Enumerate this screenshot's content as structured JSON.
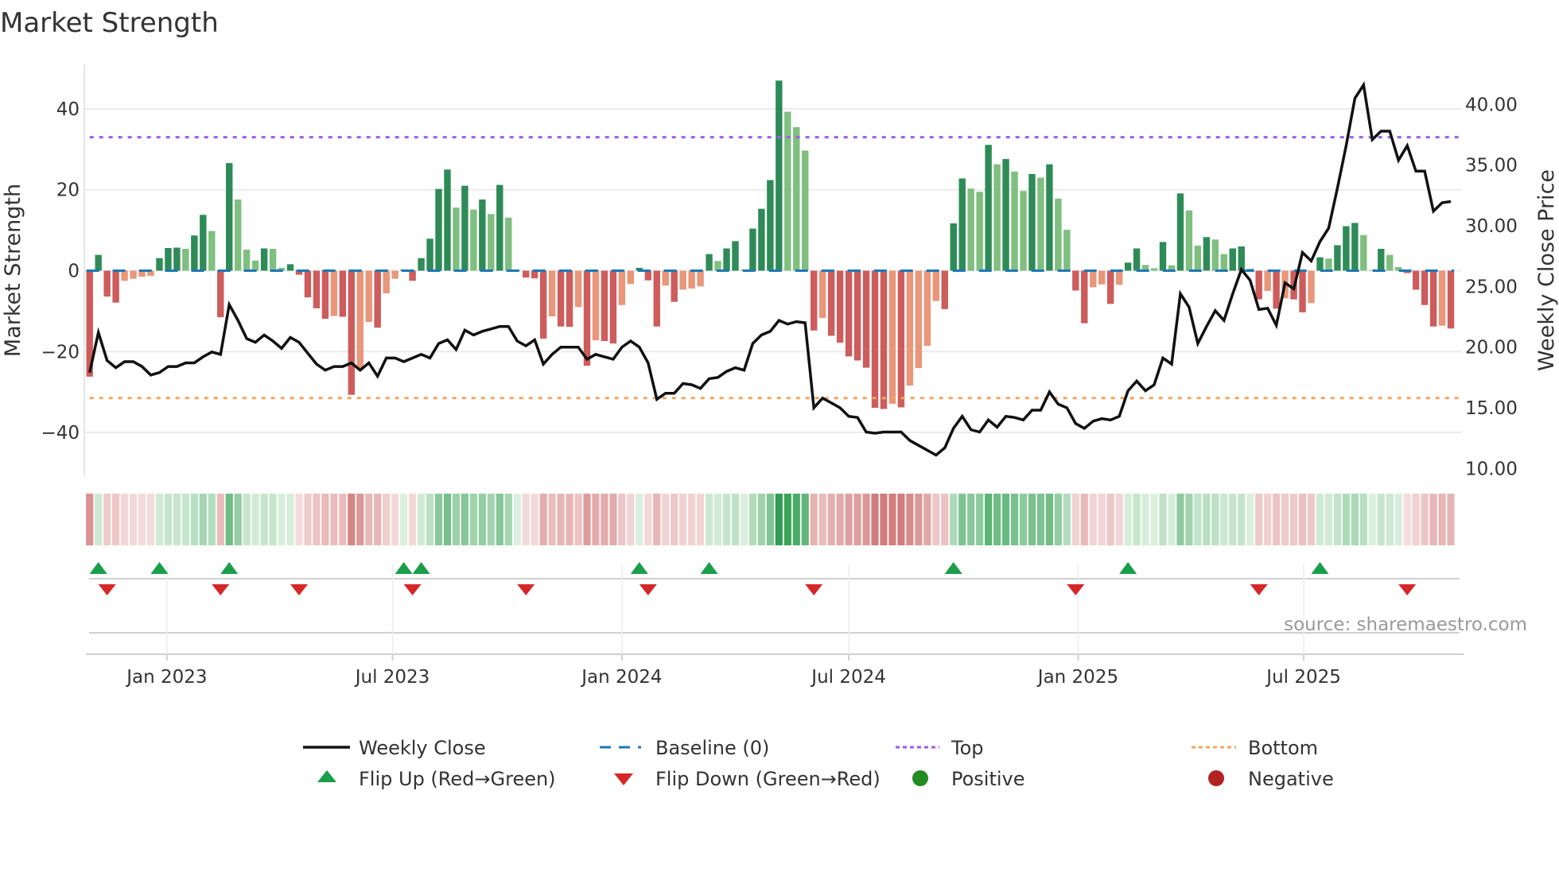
{
  "chart_data": {
    "type": "bar",
    "title": "Market Strength",
    "ylabel": "Market Strength",
    "y2label": "Weekly Close Price",
    "ylim": [
      -51,
      51
    ],
    "y2lim": [
      9.3,
      43.3
    ],
    "yticks": [
      40,
      20,
      0,
      -20,
      -40
    ],
    "yticklabels": [
      "40",
      "20",
      "0",
      "−20",
      "−40"
    ],
    "y2ticks": [
      40,
      35,
      30,
      25,
      20,
      15,
      10
    ],
    "y2ticklabels": [
      "40.00",
      "35.00",
      "30.00",
      "25.00",
      "20.00",
      "15.00",
      "10.00"
    ],
    "xticks": [
      "2023-01-01",
      "2023-07-01",
      "2024-01-01",
      "2024-07-01",
      "2025-01-01",
      "2025-07-01"
    ],
    "xticklabels": [
      "Jan 2023",
      "Jul 2023",
      "Jan 2024",
      "Jul 2024",
      "Jan 2025",
      "Jul 2025"
    ],
    "start_date": "2022-10-31",
    "frequency": "weekly",
    "top_level": 33.0,
    "bottom_level": -31.5,
    "baseline": 0,
    "strength": [
      -26.2,
      3.9,
      -6.4,
      -7.9,
      -2.5,
      -2.0,
      -1.5,
      -1.3,
      3.1,
      5.6,
      5.7,
      5.4,
      8.7,
      13.8,
      9.8,
      -11.5,
      26.6,
      17.6,
      5.2,
      2.5,
      5.5,
      5.4,
      0.7,
      1.6,
      -1.0,
      -6.6,
      -9.3,
      -11.9,
      -11.2,
      -11.4,
      -30.7,
      -24.5,
      -12.7,
      -14.1,
      -5.6,
      -2.0,
      0.3,
      -2.5,
      3.1,
      7.9,
      20.2,
      25.0,
      15.6,
      21.0,
      15.1,
      17.6,
      14.0,
      21.2,
      13.1,
      0.2,
      -1.7,
      -1.9,
      -16.8,
      -11.3,
      -13.8,
      -13.9,
      -9.0,
      -23.5,
      -17.2,
      -17.4,
      -18.0,
      -8.5,
      -3.3,
      0.7,
      -2.4,
      -13.8,
      -3.7,
      -7.7,
      -4.7,
      -4.4,
      -3.9,
      4.1,
      2.4,
      5.5,
      7.3,
      0.3,
      10.4,
      15.3,
      22.4,
      47.0,
      39.3,
      35.5,
      29.7,
      -14.8,
      -11.7,
      -16.1,
      -17.8,
      -21.2,
      -22.2,
      -24.0,
      -33.9,
      -34.2,
      -32.9,
      -33.8,
      -28.4,
      -24.1,
      -18.6,
      -7.5,
      -9.5,
      11.7,
      22.8,
      20.3,
      19.5,
      31.1,
      26.3,
      27.6,
      24.5,
      19.7,
      23.9,
      23.0,
      26.3,
      17.8,
      10.1,
      -4.9,
      -13.0,
      -4.1,
      -3.4,
      -8.2,
      -3.5,
      2.0,
      5.5,
      1.4,
      0.6,
      7.1,
      1.3,
      19.1,
      14.9,
      6.2,
      8.3,
      7.7,
      4.1,
      5.5,
      6.0,
      0.5,
      -7.1,
      -5.0,
      -9.4,
      -6.8,
      -7.1,
      -10.3,
      -8.0,
      3.3,
      3.0,
      6.3,
      11.0,
      11.8,
      8.8,
      0.2,
      5.4,
      3.9,
      0.9,
      -0.6,
      -4.7,
      -8.5,
      -13.8,
      -13.6,
      -14.3
    ],
    "weekly_close": [
      17.9,
      21.2,
      18.9,
      18.3,
      18.8,
      18.8,
      18.4,
      17.7,
      17.9,
      18.4,
      18.4,
      18.7,
      18.7,
      19.2,
      19.6,
      19.4,
      23.5,
      22.2,
      20.7,
      20.4,
      21.0,
      20.5,
      19.9,
      20.8,
      20.4,
      19.5,
      18.6,
      18.1,
      18.4,
      18.4,
      18.7,
      18.1,
      18.7,
      17.6,
      19.1,
      19.1,
      18.8,
      19.1,
      19.4,
      19.1,
      20.3,
      20.6,
      19.8,
      21.4,
      21.0,
      21.3,
      21.5,
      21.7,
      21.7,
      20.5,
      20.1,
      20.6,
      18.6,
      19.4,
      20.0,
      20.0,
      20.0,
      19.0,
      19.4,
      19.2,
      19.0,
      20.0,
      20.5,
      20.0,
      18.7,
      15.7,
      16.2,
      16.2,
      17.0,
      16.9,
      16.6,
      17.4,
      17.5,
      18.0,
      18.3,
      18.1,
      20.3,
      21.0,
      21.3,
      22.2,
      21.9,
      22.1,
      22.0,
      15.0,
      15.8,
      15.4,
      15.0,
      14.3,
      14.2,
      13.0,
      12.9,
      13.0,
      13.0,
      13.0,
      12.3,
      11.9,
      11.5,
      11.1,
      11.7,
      13.3,
      14.3,
      13.2,
      13.0,
      14.0,
      13.4,
      14.3,
      14.2,
      14.0,
      14.8,
      14.8,
      16.3,
      15.3,
      15.0,
      13.7,
      13.3,
      13.9,
      14.1,
      14.0,
      14.3,
      16.4,
      17.2,
      16.4,
      16.9,
      19.1,
      18.6,
      24.4,
      23.3,
      20.3,
      21.7,
      23.0,
      22.2,
      24.4,
      26.4,
      25.5,
      23.1,
      23.2,
      21.8,
      25.3,
      24.8,
      27.8,
      27.1,
      28.7,
      29.8,
      33.1,
      36.6,
      40.5,
      41.6,
      37.1,
      37.8,
      37.8,
      35.4,
      36.6,
      34.5,
      34.5,
      31.2,
      31.9,
      32.0
    ],
    "flip_up": [
      "2022-11-07",
      "2022-12-26",
      "2023-02-20",
      "2023-07-10",
      "2023-07-24",
      "2024-01-15",
      "2024-03-11",
      "2024-09-23",
      "2025-02-10",
      "2025-07-14"
    ],
    "flip_down": [
      "2022-11-14",
      "2023-02-13",
      "2023-04-17",
      "2023-07-17",
      "2023-10-16",
      "2024-01-22",
      "2024-06-03",
      "2024-12-30",
      "2025-05-26",
      "2025-09-22"
    ],
    "legend": {
      "placement": "bottom",
      "weekly_close": "Weekly Close",
      "baseline": "Baseline (0)",
      "top": "Top",
      "bottom": "Bottom",
      "flip_up": "Flip Up (Red→Green)",
      "flip_down": "Flip Down (Green→Red)",
      "positive": "Positive",
      "negative": "Negative"
    },
    "source": "source: sharemaestro.com"
  },
  "colors": {
    "pos_strong": "#2e8b57",
    "pos_weak": "#7fbf7f",
    "neg_strong": "#cd5c5c",
    "neg_weak": "#e9967a",
    "line": "#111111",
    "baseline": "#1f77b4",
    "top": "#9b5de5",
    "bottom": "#f4a460",
    "flip_up": "#1a9e4a",
    "flip_down": "#d62728",
    "positive": "#228b22",
    "negative": "#b22222"
  }
}
